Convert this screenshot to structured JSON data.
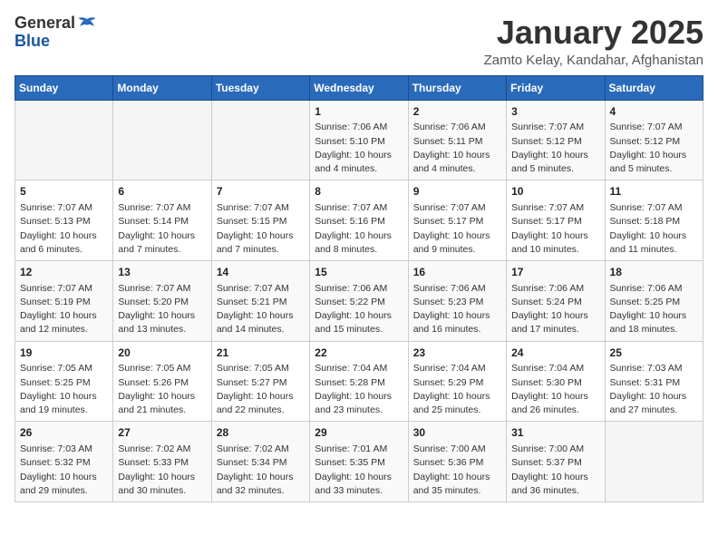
{
  "header": {
    "logo_general": "General",
    "logo_blue": "Blue",
    "month_title": "January 2025",
    "subtitle": "Zamto Kelay, Kandahar, Afghanistan"
  },
  "weekdays": [
    "Sunday",
    "Monday",
    "Tuesday",
    "Wednesday",
    "Thursday",
    "Friday",
    "Saturday"
  ],
  "weeks": [
    [
      {
        "day": "",
        "info": ""
      },
      {
        "day": "",
        "info": ""
      },
      {
        "day": "",
        "info": ""
      },
      {
        "day": "1",
        "info": "Sunrise: 7:06 AM\nSunset: 5:10 PM\nDaylight: 10 hours\nand 4 minutes."
      },
      {
        "day": "2",
        "info": "Sunrise: 7:06 AM\nSunset: 5:11 PM\nDaylight: 10 hours\nand 4 minutes."
      },
      {
        "day": "3",
        "info": "Sunrise: 7:07 AM\nSunset: 5:12 PM\nDaylight: 10 hours\nand 5 minutes."
      },
      {
        "day": "4",
        "info": "Sunrise: 7:07 AM\nSunset: 5:12 PM\nDaylight: 10 hours\nand 5 minutes."
      }
    ],
    [
      {
        "day": "5",
        "info": "Sunrise: 7:07 AM\nSunset: 5:13 PM\nDaylight: 10 hours\nand 6 minutes."
      },
      {
        "day": "6",
        "info": "Sunrise: 7:07 AM\nSunset: 5:14 PM\nDaylight: 10 hours\nand 7 minutes."
      },
      {
        "day": "7",
        "info": "Sunrise: 7:07 AM\nSunset: 5:15 PM\nDaylight: 10 hours\nand 7 minutes."
      },
      {
        "day": "8",
        "info": "Sunrise: 7:07 AM\nSunset: 5:16 PM\nDaylight: 10 hours\nand 8 minutes."
      },
      {
        "day": "9",
        "info": "Sunrise: 7:07 AM\nSunset: 5:17 PM\nDaylight: 10 hours\nand 9 minutes."
      },
      {
        "day": "10",
        "info": "Sunrise: 7:07 AM\nSunset: 5:17 PM\nDaylight: 10 hours\nand 10 minutes."
      },
      {
        "day": "11",
        "info": "Sunrise: 7:07 AM\nSunset: 5:18 PM\nDaylight: 10 hours\nand 11 minutes."
      }
    ],
    [
      {
        "day": "12",
        "info": "Sunrise: 7:07 AM\nSunset: 5:19 PM\nDaylight: 10 hours\nand 12 minutes."
      },
      {
        "day": "13",
        "info": "Sunrise: 7:07 AM\nSunset: 5:20 PM\nDaylight: 10 hours\nand 13 minutes."
      },
      {
        "day": "14",
        "info": "Sunrise: 7:07 AM\nSunset: 5:21 PM\nDaylight: 10 hours\nand 14 minutes."
      },
      {
        "day": "15",
        "info": "Sunrise: 7:06 AM\nSunset: 5:22 PM\nDaylight: 10 hours\nand 15 minutes."
      },
      {
        "day": "16",
        "info": "Sunrise: 7:06 AM\nSunset: 5:23 PM\nDaylight: 10 hours\nand 16 minutes."
      },
      {
        "day": "17",
        "info": "Sunrise: 7:06 AM\nSunset: 5:24 PM\nDaylight: 10 hours\nand 17 minutes."
      },
      {
        "day": "18",
        "info": "Sunrise: 7:06 AM\nSunset: 5:25 PM\nDaylight: 10 hours\nand 18 minutes."
      }
    ],
    [
      {
        "day": "19",
        "info": "Sunrise: 7:05 AM\nSunset: 5:25 PM\nDaylight: 10 hours\nand 19 minutes."
      },
      {
        "day": "20",
        "info": "Sunrise: 7:05 AM\nSunset: 5:26 PM\nDaylight: 10 hours\nand 21 minutes."
      },
      {
        "day": "21",
        "info": "Sunrise: 7:05 AM\nSunset: 5:27 PM\nDaylight: 10 hours\nand 22 minutes."
      },
      {
        "day": "22",
        "info": "Sunrise: 7:04 AM\nSunset: 5:28 PM\nDaylight: 10 hours\nand 23 minutes."
      },
      {
        "day": "23",
        "info": "Sunrise: 7:04 AM\nSunset: 5:29 PM\nDaylight: 10 hours\nand 25 minutes."
      },
      {
        "day": "24",
        "info": "Sunrise: 7:04 AM\nSunset: 5:30 PM\nDaylight: 10 hours\nand 26 minutes."
      },
      {
        "day": "25",
        "info": "Sunrise: 7:03 AM\nSunset: 5:31 PM\nDaylight: 10 hours\nand 27 minutes."
      }
    ],
    [
      {
        "day": "26",
        "info": "Sunrise: 7:03 AM\nSunset: 5:32 PM\nDaylight: 10 hours\nand 29 minutes."
      },
      {
        "day": "27",
        "info": "Sunrise: 7:02 AM\nSunset: 5:33 PM\nDaylight: 10 hours\nand 30 minutes."
      },
      {
        "day": "28",
        "info": "Sunrise: 7:02 AM\nSunset: 5:34 PM\nDaylight: 10 hours\nand 32 minutes."
      },
      {
        "day": "29",
        "info": "Sunrise: 7:01 AM\nSunset: 5:35 PM\nDaylight: 10 hours\nand 33 minutes."
      },
      {
        "day": "30",
        "info": "Sunrise: 7:00 AM\nSunset: 5:36 PM\nDaylight: 10 hours\nand 35 minutes."
      },
      {
        "day": "31",
        "info": "Sunrise: 7:00 AM\nSunset: 5:37 PM\nDaylight: 10 hours\nand 36 minutes."
      },
      {
        "day": "",
        "info": ""
      }
    ]
  ]
}
